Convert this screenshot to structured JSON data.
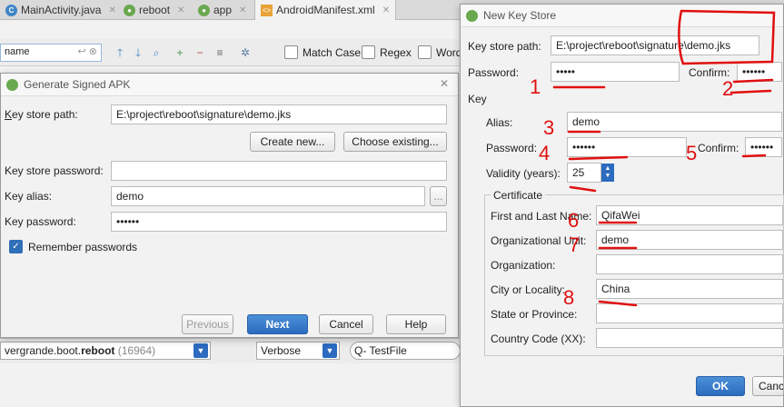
{
  "tabs": [
    {
      "icon": "class-icon",
      "label": "MainActivity.java"
    },
    {
      "icon": "module-icon",
      "label": "reboot"
    },
    {
      "icon": "module-icon",
      "label": "app"
    },
    {
      "icon": "xml-file-icon",
      "label": "AndroidManifest.xml"
    }
  ],
  "search": {
    "value": "name",
    "match_case": "Match Case",
    "regex": "Regex",
    "words": "Words"
  },
  "generate_dialog": {
    "title": "Generate Signed APK",
    "key_store_path_label": "Key store path:",
    "key_store_path_value": "E:\\project\\reboot\\signature\\demo.jks",
    "create_new": "Create new...",
    "choose_existing": "Choose existing...",
    "key_store_password_label": "Key store password:",
    "key_alias_label": "Key alias:",
    "key_alias_value": "demo",
    "browse_label": "...",
    "key_password_label": "Key password:",
    "key_password_value": "••••••",
    "remember_passwords": "Remember passwords",
    "previous": "Previous",
    "next": "Next",
    "cancel": "Cancel",
    "help": "Help"
  },
  "bottom_bar": {
    "process_prefix": "vergrande.boot.",
    "process_bold": "reboot",
    "process_pid": "(16964)",
    "log_level": "Verbose",
    "filter_value": "Q- TestFile"
  },
  "new_key_dialog": {
    "title": "New Key Store",
    "key_store_path_label": "Key store path:",
    "key_store_path_value": "E:\\project\\reboot\\signature\\demo.jks",
    "password_label": "Password:",
    "password_value": "•••••",
    "confirm_label": "Confirm:",
    "confirm_value": "••••••",
    "key_section": "Key",
    "alias_label": "Alias:",
    "alias_value": "demo",
    "key_password_label": "Password:",
    "key_password_value": "••••••",
    "key_confirm_label": "Confirm:",
    "key_confirm_value": "••••••",
    "validity_label": "Validity (years):",
    "validity_value": "25",
    "certificate_title": "Certificate",
    "first_last_label": "First and Last Name:",
    "first_last_value": "QifaWei",
    "org_unit_label": "Organizational Unit:",
    "org_unit_value": "demo",
    "org_label": "Organization:",
    "org_value": "",
    "city_label": "City or Locality:",
    "city_value": "China",
    "state_label": "State or Province:",
    "state_value": "",
    "country_label": "Country Code (XX):",
    "country_value": "",
    "ok": "OK",
    "cancel": "Cancel"
  },
  "annotations": [
    "1",
    "2",
    "3",
    "4",
    "5",
    "6",
    "7",
    "8"
  ]
}
